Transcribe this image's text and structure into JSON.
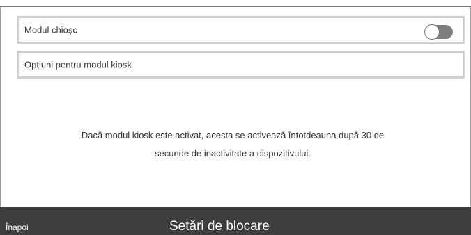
{
  "settings": {
    "kiosk_mode": {
      "label": "Modul chioșc",
      "enabled": false
    },
    "kiosk_options_label": "Opțiuni pentru modul kiosk"
  },
  "info_text": {
    "line1": "Dacă modul kiosk este activat, acesta se activează întotdeauna după 30 de",
    "line2": "secunde de inactivitate a dispozitivului."
  },
  "footer": {
    "back_label": "Înapoi",
    "title": "Setări de blocare"
  },
  "colors": {
    "bar_background": "#3d3d3d",
    "row_border": "#cfcfcf",
    "toggle_track_off": "#7d7d7d"
  }
}
